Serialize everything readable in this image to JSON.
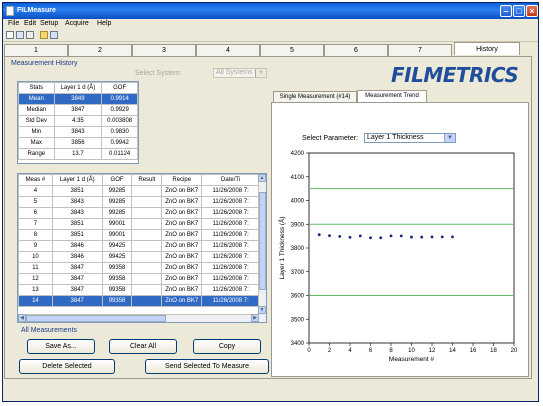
{
  "window": {
    "title": "FILMeasure"
  },
  "menu": [
    "File",
    "Edit",
    "Setup",
    "Acquire",
    "Help"
  ],
  "toolbar_icons": [
    "new-icon",
    "save-icon",
    "print-icon",
    "folder-icon",
    "export-icon"
  ],
  "tabs": [
    "1",
    "2",
    "3",
    "4",
    "5",
    "6",
    "7",
    "History"
  ],
  "active_tab": "History",
  "history": {
    "section_label": "Measurement History",
    "select_system_label": "Select System:",
    "select_system_value": "All Systems",
    "stats_headers": [
      "Stats",
      "Layer 1 d (Å)",
      "GOF"
    ],
    "stats_rows": [
      [
        "Mean",
        "3849",
        "0.9914"
      ],
      [
        "Median",
        "3847",
        "0.9929"
      ],
      [
        "Std Dev",
        "4.35",
        "0.003808"
      ],
      [
        "Min",
        "3843",
        "0.9830"
      ],
      [
        "Max",
        "3856",
        "0.9942"
      ],
      [
        "Range",
        "13.7",
        "0.01124"
      ]
    ],
    "meas_headers": [
      "Meas #",
      "Layer 1 d (Å)",
      "GOF",
      "Result",
      "Recipe",
      "Date/Ti"
    ],
    "meas_rows": [
      [
        "4",
        "3851",
        "99285",
        "",
        "ZnO on BK7",
        "11/26/2008 7:"
      ],
      [
        "5",
        "3843",
        "99285",
        "",
        "ZnO on BK7",
        "11/26/2008 7:"
      ],
      [
        "6",
        "3843",
        "99285",
        "",
        "ZnO on BK7",
        "11/26/2008 7:"
      ],
      [
        "7",
        "3851",
        "99001",
        "",
        "ZnO on BK7",
        "11/26/2008 7:"
      ],
      [
        "8",
        "3851",
        "99001",
        "",
        "ZnO on BK7",
        "11/26/2008 7:"
      ],
      [
        "9",
        "3846",
        "99425",
        "",
        "ZnO on BK7",
        "11/26/2008 7:"
      ],
      [
        "10",
        "3846",
        "99425",
        "",
        "ZnO on BK7",
        "11/26/2008 7:"
      ],
      [
        "11",
        "3847",
        "99358",
        "",
        "ZnO on BK7",
        "11/26/2008 7:"
      ],
      [
        "12",
        "3847",
        "99358",
        "",
        "ZnO on BK7",
        "11/26/2008 7:"
      ],
      [
        "13",
        "3847",
        "99358",
        "",
        "ZnO on BK7",
        "11/26/2008 7:"
      ],
      [
        "14",
        "3847",
        "99358",
        "",
        "ZnO on BK7",
        "11/26/2008 7:"
      ]
    ],
    "selected_meas": "14",
    "all_measurements_label": "All Measurements",
    "buttons": {
      "save_as": "Save As...",
      "clear_all": "Clear All",
      "copy": "Copy",
      "delete_selected": "Delete Selected",
      "send_selected": "Send Selected To Measure"
    }
  },
  "brand": "FILMETRICS",
  "subtabs": [
    "Single Measurement (#14)",
    "Measurement Trend"
  ],
  "active_subtab": "Measurement Trend",
  "trend": {
    "select_parameter_label": "Select Parameter:",
    "select_parameter_value": "Layer 1 Thickness"
  },
  "colors": {
    "selection": "#316ac5",
    "brand": "#1f4e9c",
    "reference_lines": "#66bb66",
    "series": "#1a237e"
  },
  "chart_data": {
    "type": "scatter",
    "xlabel": "Measurement #",
    "ylabel": "Layer 1 Thickness (Å)",
    "xlim": [
      0,
      20
    ],
    "ylim": [
      3400,
      4200
    ],
    "xticks": [
      0,
      2,
      4,
      6,
      8,
      10,
      12,
      14,
      16,
      18,
      20
    ],
    "yticks": [
      3400,
      3500,
      3600,
      3700,
      3800,
      3900,
      4000,
      4100,
      4200
    ],
    "grid": true,
    "reference_lines": [
      3600,
      3900,
      4050
    ],
    "x": [
      1,
      2,
      3,
      4,
      5,
      6,
      7,
      8,
      9,
      10,
      11,
      12,
      13,
      14
    ],
    "y": [
      3856,
      3852,
      3849,
      3845,
      3851,
      3843,
      3843,
      3851,
      3851,
      3846,
      3846,
      3847,
      3847,
      3847
    ]
  }
}
